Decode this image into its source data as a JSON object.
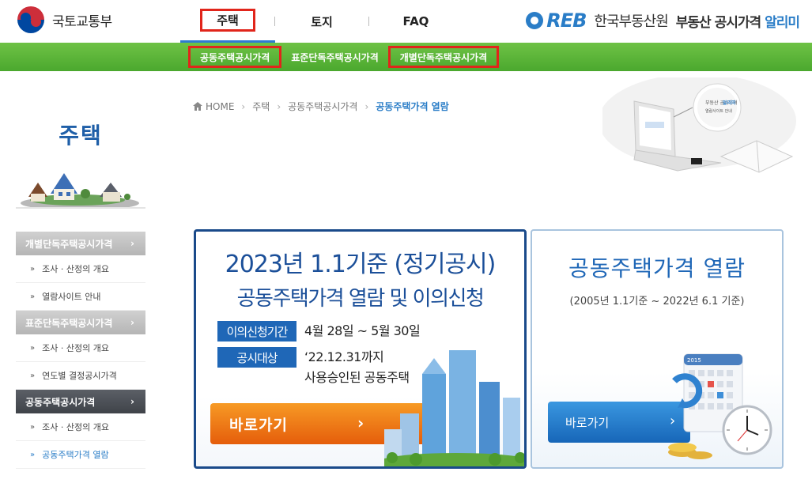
{
  "header": {
    "gov_name": "국토교통부",
    "nav": [
      "주택",
      "토지",
      "FAQ"
    ],
    "reb_logo": "REB",
    "reb_name": "한국부동산원",
    "site_title_1": "부동산 공시가격",
    "site_title_2": "알리미"
  },
  "subnav": [
    "공동주택공시가격",
    "표준단독주택공시가격",
    "개별단독주택공시가격"
  ],
  "breadcrumb": {
    "home": "HOME",
    "items": [
      "주택",
      "공동주택공시가격"
    ],
    "current": "공동주택가격 열람"
  },
  "laptop_screen": {
    "line1": "부동산 공시가격",
    "line2": "알리미",
    "line3": "열람사이트 안내"
  },
  "sidebar": {
    "title": "주택",
    "menu": [
      {
        "label": "개별단독주택공시가격",
        "subs": [
          "조사 · 산정의 개요",
          "열람사이트 안내"
        ]
      },
      {
        "label": "표준단독주택공시가격",
        "subs": [
          "조사 · 산정의 개요",
          "연도별 결정공시가격"
        ]
      },
      {
        "label": "공동주택공시가격",
        "subs": [
          "조사 · 산정의 개요",
          "공동주택가격 열람"
        ]
      }
    ],
    "arrow": "›",
    "bullet": "»"
  },
  "card1": {
    "title": "2023년 1.1기준 (정기공시)",
    "subtitle": "공동주택가격 열람 및 이의신청",
    "badge1": "이의신청기간",
    "value1": "4월 28일 ~ 5월 30일",
    "badge2": "공시대상",
    "value2_line1": "‘22.12.31까지",
    "value2_line2": "사용승인된 공동주택",
    "button": "바로가기"
  },
  "card2": {
    "title": "공동주택가격 열람",
    "subtitle": "(2005년 1.1기준 ~ 2022년 6.1 기준)",
    "button": "바로가기",
    "calendar_year": "2015"
  },
  "colors": {
    "green_bar": "#5bb53a",
    "highlight_red": "#e1251b",
    "title_blue": "#1b4f99",
    "orange_button": "#f0801a",
    "blue_button": "#1f67b7"
  }
}
